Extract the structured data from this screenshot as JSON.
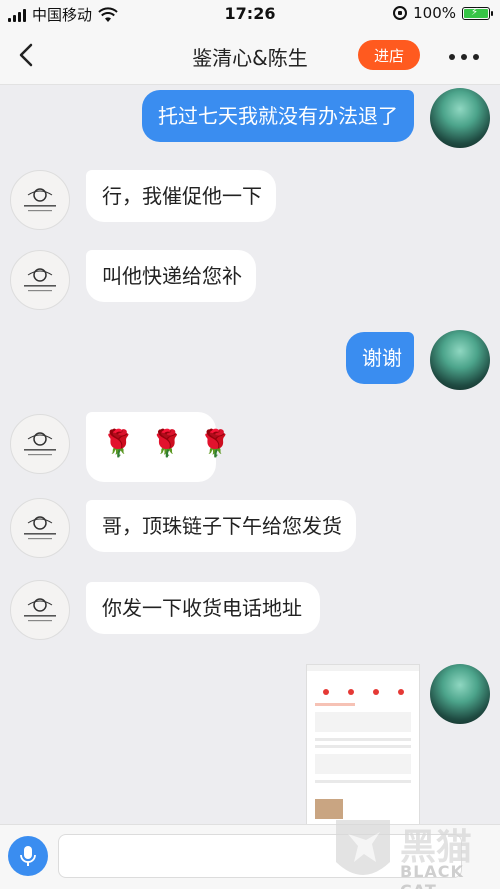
{
  "status_bar": {
    "carrier": "中国移动",
    "time": "17:26",
    "battery_percent": "100%"
  },
  "header": {
    "title": "鉴清心&陈生",
    "store_button": "进店",
    "more_label": "more"
  },
  "messages": [
    {
      "side": "right",
      "text": "托过七天我就没有办法退了"
    },
    {
      "side": "left",
      "text": "行，我催促他一下"
    },
    {
      "side": "left",
      "text": "叫他快递给您补"
    },
    {
      "side": "right",
      "text": "谢谢"
    },
    {
      "side": "left",
      "text": "🌹 🌹 🌹"
    },
    {
      "side": "left",
      "text": "哥，顶珠链子下午给您发货"
    },
    {
      "side": "left",
      "text": "你发一下收货电话地址"
    },
    {
      "side": "right",
      "type": "image",
      "icon": "order-screenshot"
    }
  ],
  "input": {
    "placeholder": ""
  },
  "watermark": {
    "text": "黑猫",
    "sub": "BLACK CAT"
  },
  "colors": {
    "accent_blue": "#3a8df0",
    "store_orange": "#ff5a1f",
    "battery_green": "#36c446"
  }
}
